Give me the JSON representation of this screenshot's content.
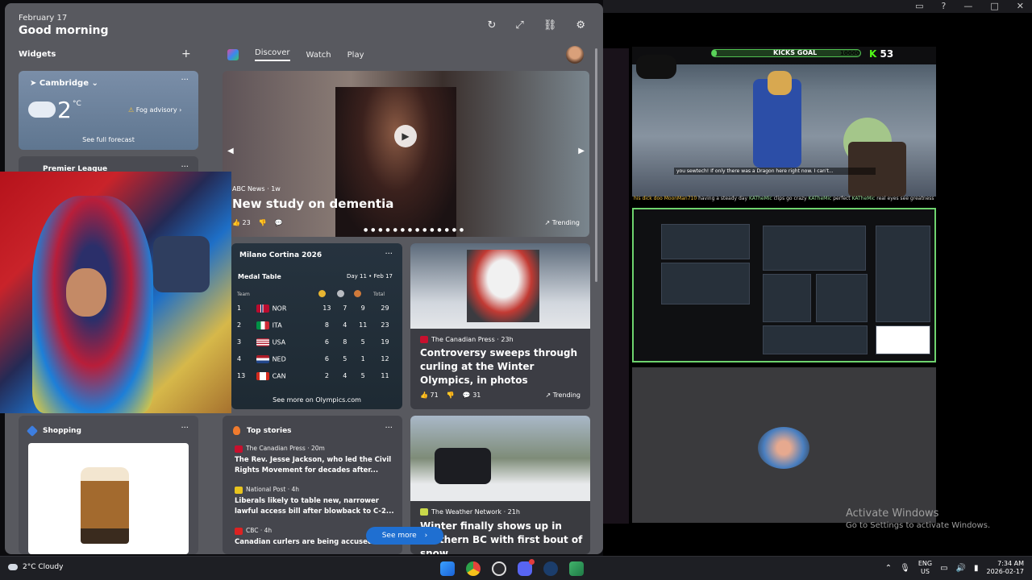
{
  "obs": {
    "window_controls": [
      "▭",
      "?",
      "—",
      "□",
      "✕"
    ],
    "hud": {
      "label": "KICKS GOAL",
      "goal": "10000",
      "count": "53",
      "progress": 0.0053
    },
    "game_subtitle": "you sewtech! If only there was a Dragon here right now. I can't...",
    "chat": {
      "user1": "his dick doo",
      "user2": "MoonMan710",
      "text": " having a steady day ",
      "emote1": "KATheMic",
      "text2": " clips go crazy ",
      "emote2": "KATheMic",
      "text3": " perfect ",
      "emote3": "KATheMic",
      "text4": " real eyes see greatness"
    }
  },
  "activate": {
    "title": "Activate Windows",
    "subtitle": "Go to Settings to activate Windows."
  },
  "widgets": {
    "date": "February 17",
    "greeting": "Good morning",
    "section_label": "Widgets",
    "add_icon": "+",
    "tool_icons": [
      "↻",
      "⤢",
      "⛓",
      "⚙"
    ],
    "tabs": [
      "Discover",
      "Watch",
      "Play"
    ],
    "weather": {
      "city": "Cambridge",
      "temp": "2",
      "unit": "°C",
      "advisory": "Fog advisory",
      "forecast": "See full forecast"
    },
    "premier": {
      "label": "Premier League"
    },
    "hero": {
      "source": "ABC News · 1w",
      "title": "New study on dementia",
      "likes": "23",
      "trending": "Trending"
    },
    "olympics": {
      "title": "Milano Cortina 2026",
      "medal_table": "Medal Table",
      "dates": "Day 11 • Feb 17",
      "headers": {
        "team": "Team",
        "total": "Total"
      },
      "medal_colors": [
        "#e8b531",
        "#b9bcc2",
        "#d07a3a"
      ],
      "rows": [
        {
          "rank": "1",
          "country": "NOR",
          "g": "13",
          "s": "7",
          "b": "9",
          "t": "29",
          "flag": "nor"
        },
        {
          "rank": "2",
          "country": "ITA",
          "g": "8",
          "s": "4",
          "b": "11",
          "t": "23",
          "flag": "ita"
        },
        {
          "rank": "3",
          "country": "USA",
          "g": "6",
          "s": "8",
          "b": "5",
          "t": "19",
          "flag": "usa"
        },
        {
          "rank": "4",
          "country": "NED",
          "g": "6",
          "s": "5",
          "b": "1",
          "t": "12",
          "flag": "ned"
        },
        {
          "rank": "13",
          "country": "CAN",
          "g": "2",
          "s": "4",
          "b": "5",
          "t": "11",
          "flag": "can"
        }
      ],
      "see_more": "See more on Olympics.com"
    },
    "curling": {
      "source": "The Canadian Press · 23h",
      "title": "Controversy sweeps through curling at the Winter Olympics, in photos",
      "likes": "71",
      "comments": "31",
      "trending": "Trending"
    },
    "shopping": {
      "label": "Shopping"
    },
    "top_stories": {
      "label": "Top stories",
      "items": [
        {
          "source": "The Canadian Press · 20m",
          "headline": "The Rev. Jesse Jackson, who led the Civil Rights Movement for decades after..."
        },
        {
          "source": "National Post · 4h",
          "headline": "Liberals likely to table new, narrower lawful access bill after blowback to C-2..."
        },
        {
          "source": "CBC · 4h",
          "headline": "Canadian curlers are being accused of"
        }
      ],
      "see_more": "See more"
    },
    "weather_story": {
      "source": "The Weather Network · 21h",
      "title": "Winter finally shows up in southern BC with first bout of snow"
    }
  },
  "taskbar": {
    "weather": "2°C Cloudy",
    "lang": "ENG",
    "region": "US",
    "time": "7:34 AM",
    "date": "2026-02-17"
  }
}
